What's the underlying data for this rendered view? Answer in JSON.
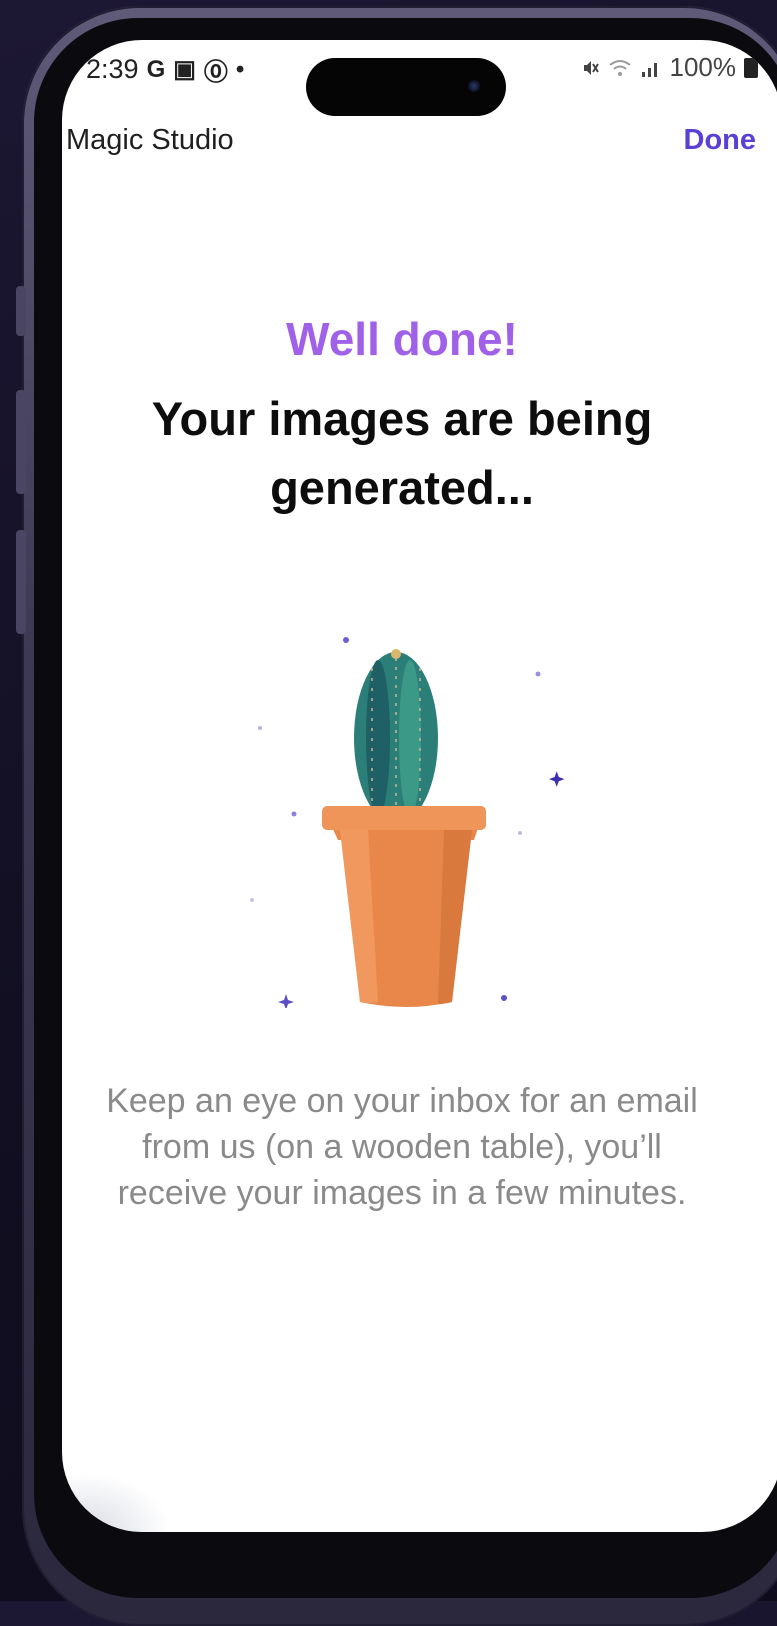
{
  "status_bar": {
    "time": "2:39",
    "left_icons": [
      "G",
      "▣",
      "⓪",
      "•"
    ],
    "right_text": "100%",
    "right_icons": [
      "mute-icon",
      "wifi-icon",
      "signal-icon",
      "battery-icon"
    ]
  },
  "nav": {
    "title": "Magic Studio",
    "done_label": "Done"
  },
  "content": {
    "headline": "Well done!",
    "subheadline_line1": "Your images are being",
    "subheadline_line2": "generated...",
    "body_line1": "Keep an eye on your inbox for an email",
    "body_line2": "from us (on a wooden table), you’ll",
    "body_line3": "receive your images in a few minutes."
  },
  "colors": {
    "accent": "#5b3fd6",
    "headline": "#a061e8",
    "pot": "#e9874a",
    "cactus": "#2c7f78"
  }
}
